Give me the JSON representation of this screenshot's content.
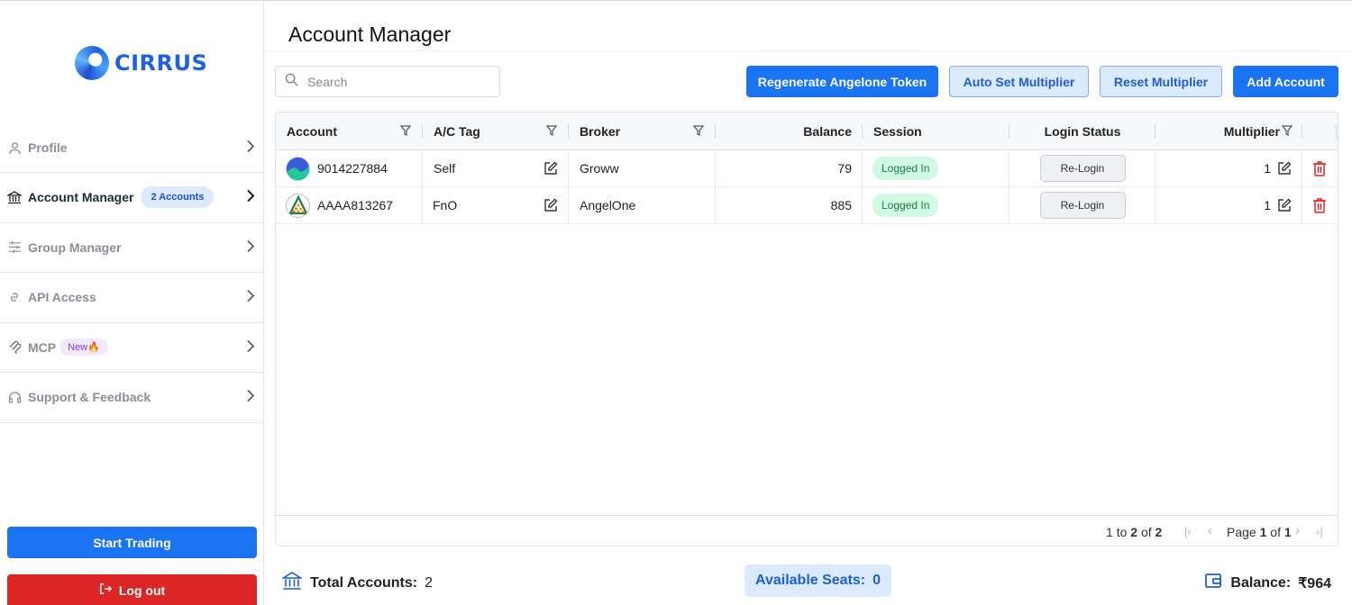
{
  "app": {
    "logo_text": "CIRRUS",
    "accent": "#1a73f0",
    "danger": "#dc2626"
  },
  "sidebar": {
    "items": [
      {
        "label": "Profile",
        "icon": "user-icon"
      },
      {
        "label": "Account Manager",
        "icon": "bank-icon",
        "badge": "2 Accounts"
      },
      {
        "label": "Group Manager",
        "icon": "sliders-icon"
      },
      {
        "label": "API Access",
        "icon": "link-icon"
      },
      {
        "label": "MCP",
        "icon": "mcp-icon",
        "badge": "New🔥"
      },
      {
        "label": "Support & Feedback",
        "icon": "headset-icon"
      }
    ],
    "start_trading": "Start Trading",
    "logout": "Log out"
  },
  "main": {
    "title": "Account Manager",
    "search_placeholder": "Search",
    "buttons": {
      "regenerate": "Regenerate Angelone Token",
      "auto_set": "Auto Set Multiplier",
      "reset": "Reset Multiplier",
      "add": "Add Account"
    }
  },
  "table": {
    "columns": [
      "Account",
      "A/C Tag",
      "Broker",
      "Balance",
      "Session",
      "Login Status",
      "Multiplier"
    ],
    "rows": [
      {
        "account": "9014227884",
        "tag": "Self",
        "broker": "Groww",
        "balance": "79",
        "session": "Logged In",
        "login_action": "Re-Login",
        "multiplier": "1"
      },
      {
        "account": "AAAA813267",
        "tag": "FnO",
        "broker": "AngelOne",
        "balance": "885",
        "session": "Logged In",
        "login_action": "Re-Login",
        "multiplier": "1"
      }
    ],
    "pagination": {
      "from": "1",
      "to_label": "to",
      "to": "2",
      "of_label": "of",
      "total": "2",
      "page_label": "Page",
      "page": "1",
      "pages": "1"
    }
  },
  "footer": {
    "total_label": "Total Accounts:",
    "total_value": "2",
    "seats_label": "Available Seats:",
    "seats_value": "0",
    "balance_label": "Balance:",
    "balance_value": "₹964"
  }
}
